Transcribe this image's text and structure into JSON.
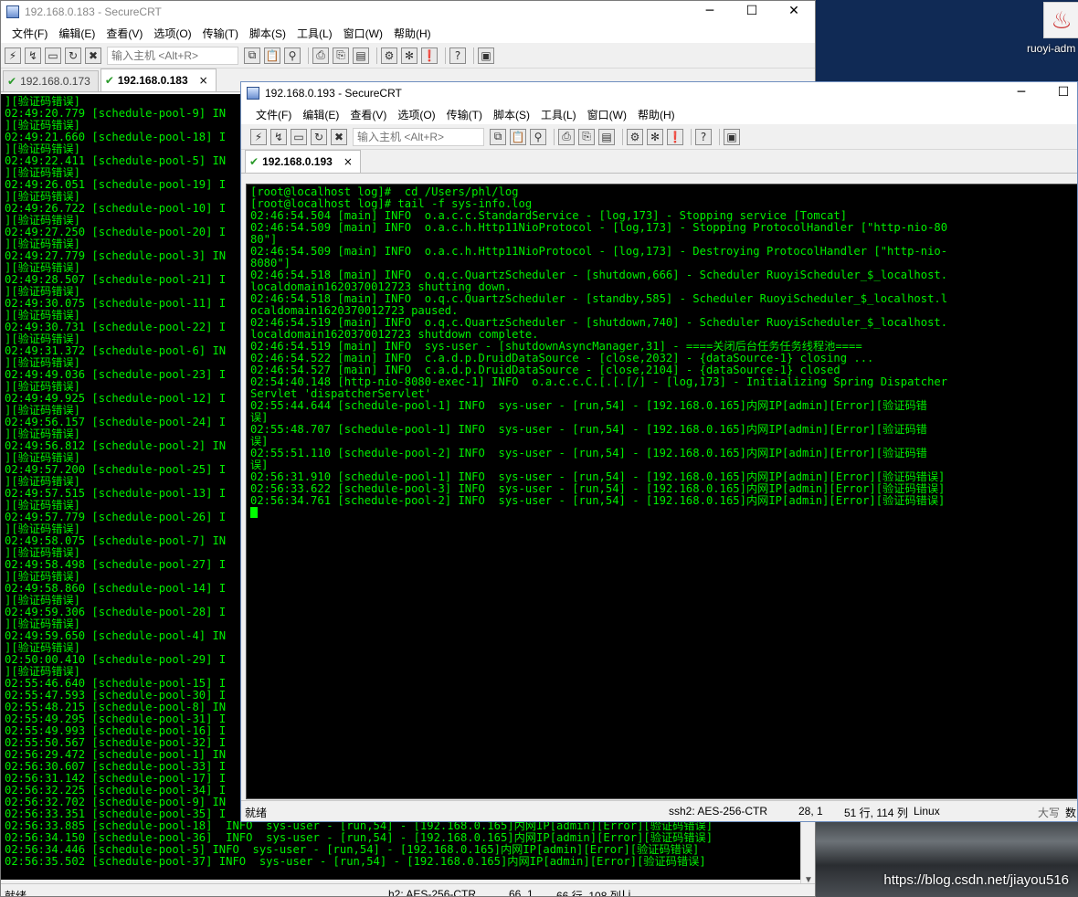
{
  "desktop": {
    "icon_label": "ruoyi-adm",
    "watermark": "https://blog.csdn.net/jiayou516"
  },
  "menu_items": [
    "文件(F)",
    "编辑(E)",
    "查看(V)",
    "选项(O)",
    "传输(T)",
    "脚本(S)",
    "工具(L)",
    "窗口(W)",
    "帮助(H)"
  ],
  "toolbar": {
    "host_placeholder": "输入主机 <Alt+R>"
  },
  "back_window": {
    "title": "192.168.0.183 - SecureCRT",
    "tabs": [
      {
        "label": "192.168.0.173",
        "active": false
      },
      {
        "label": "192.168.0.183",
        "active": true
      }
    ],
    "tab_close": "×",
    "terminal_lines": [
      "][验证码错误]",
      "02:49:20.779 [schedule-pool-9] IN",
      "][验证码错误]",
      "02:49:21.660 [schedule-pool-18] I",
      "][验证码错误]",
      "02:49:22.411 [schedule-pool-5] IN",
      "][验证码错误]",
      "02:49:26.051 [schedule-pool-19] I",
      "][验证码错误]",
      "02:49:26.722 [schedule-pool-10] I",
      "][验证码错误]",
      "02:49:27.250 [schedule-pool-20] I",
      "][验证码错误]",
      "02:49:27.779 [schedule-pool-3] IN",
      "][验证码错误]",
      "02:49:28.507 [schedule-pool-21] I",
      "][验证码错误]",
      "02:49:30.075 [schedule-pool-11] I",
      "][验证码错误]",
      "02:49:30.731 [schedule-pool-22] I",
      "][验证码错误]",
      "02:49:31.372 [schedule-pool-6] IN",
      "][验证码错误]",
      "02:49:49.036 [schedule-pool-23] I",
      "][验证码错误]",
      "02:49:49.925 [schedule-pool-12] I",
      "][验证码错误]",
      "02:49:56.157 [schedule-pool-24] I",
      "][验证码错误]",
      "02:49:56.812 [schedule-pool-2] IN",
      "][验证码错误]",
      "02:49:57.200 [schedule-pool-25] I",
      "][验证码错误]",
      "02:49:57.515 [schedule-pool-13] I",
      "][验证码错误]",
      "02:49:57.779 [schedule-pool-26] I",
      "][验证码错误]",
      "02:49:58.075 [schedule-pool-7] IN",
      "][验证码错误]",
      "02:49:58.498 [schedule-pool-27] I",
      "][验证码错误]",
      "02:49:58.860 [schedule-pool-14] I",
      "][验证码错误]",
      "02:49:59.306 [schedule-pool-28] I",
      "][验证码错误]",
      "02:49:59.650 [schedule-pool-4] IN",
      "][验证码错误]",
      "02:50:00.410 [schedule-pool-29] I",
      "][验证码错误]",
      "02:55:46.640 [schedule-pool-15] I",
      "02:55:47.593 [schedule-pool-30] I",
      "02:55:48.215 [schedule-pool-8] IN",
      "02:55:49.295 [schedule-pool-31] I",
      "02:55:49.993 [schedule-pool-16] I",
      "02:55:50.567 [schedule-pool-32] I",
      "02:56:29.472 [schedule-pool-1] IN",
      "02:56:30.607 [schedule-pool-33] I",
      "02:56:31.142 [schedule-pool-17] I",
      "02:56:32.225 [schedule-pool-34] I",
      "02:56:32.702 [schedule-pool-9] IN",
      "02:56:33.351 [schedule-pool-35] I",
      "02:56:33.885 [schedule-pool-18]  INFO  sys-user - [run,54] - [192.168.0.165]内网IP[admin][Error][验证码错误]",
      "02:56:34.150 [schedule-pool-36]  INFO  sys-user - [run,54] - [192.168.0.165]内网IP[admin][Error][验证码错误]",
      "02:56:34.446 [schedule-pool-5] INFO  sys-user - [run,54] - [192.168.0.165]内网IP[admin][Error][验证码错误]",
      "02:56:35.502 [schedule-pool-37] INFO  sys-user - [run,54] - [192.168.0.165]内网IP[admin][Error][验证码错误]"
    ],
    "status": {
      "ready": "就绪",
      "cipher": "h2: AES-256-CTR",
      "pos": "66,   1",
      "rows": "66 行, 108 列",
      "term": "Li"
    }
  },
  "front_window": {
    "title": "192.168.0.193 - SecureCRT",
    "tabs": [
      {
        "label": "192.168.0.193",
        "active": true
      }
    ],
    "tab_close": "×",
    "terminal_lines": [
      "[root@localhost log]#  cd /Users/phl/log",
      "[root@localhost log]# tail -f sys-info.log",
      "02:46:54.504 [main] INFO  o.a.c.c.StandardService - [log,173] - Stopping service [Tomcat]",
      "02:46:54.509 [main] INFO  o.a.c.h.Http11NioProtocol - [log,173] - Stopping ProtocolHandler [\"http-nio-80",
      "80\"]",
      "02:46:54.509 [main] INFO  o.a.c.h.Http11NioProtocol - [log,173] - Destroying ProtocolHandler [\"http-nio-",
      "8080\"]",
      "02:46:54.518 [main] INFO  o.q.c.QuartzScheduler - [shutdown,666] - Scheduler RuoyiScheduler_$_localhost.",
      "localdomain1620370012723 shutting down.",
      "02:46:54.518 [main] INFO  o.q.c.QuartzScheduler - [standby,585] - Scheduler RuoyiScheduler_$_localhost.l",
      "ocaldomain1620370012723 paused.",
      "02:46:54.519 [main] INFO  o.q.c.QuartzScheduler - [shutdown,740] - Scheduler RuoyiScheduler_$_localhost.",
      "localdomain1620370012723 shutdown complete.",
      "02:46:54.519 [main] INFO  sys-user - [shutdownAsyncManager,31] - ====关闭后台任务任务线程池====",
      "02:46:54.522 [main] INFO  c.a.d.p.DruidDataSource - [close,2032] - {dataSource-1} closing ...",
      "02:46:54.527 [main] INFO  c.a.d.p.DruidDataSource - [close,2104] - {dataSource-1} closed",
      "02:54:40.148 [http-nio-8080-exec-1] INFO  o.a.c.c.C.[.[.[/] - [log,173] - Initializing Spring Dispatcher",
      "Servlet 'dispatcherServlet'",
      "02:55:44.644 [schedule-pool-1] INFO  sys-user - [run,54] - [192.168.0.165]内网IP[admin][Error][验证码错",
      "误]",
      "02:55:48.707 [schedule-pool-1] INFO  sys-user - [run,54] - [192.168.0.165]内网IP[admin][Error][验证码错",
      "误]",
      "02:55:51.110 [schedule-pool-2] INFO  sys-user - [run,54] - [192.168.0.165]内网IP[admin][Error][验证码错",
      "误]",
      "02:56:31.910 [schedule-pool-1] INFO  sys-user - [run,54] - [192.168.0.165]内网IP[admin][Error][验证码错误]",
      "02:56:33.622 [schedule-pool-3] INFO  sys-user - [run,54] - [192.168.0.165]内网IP[admin][Error][验证码错误]",
      "02:56:34.761 [schedule-pool-2] INFO  sys-user - [run,54] - [192.168.0.165]内网IP[admin][Error][验证码错误]"
    ],
    "status": {
      "ready": "就绪",
      "cipher": "ssh2: AES-256-CTR",
      "pos": "28,   1",
      "rows": "51 行, 114 列",
      "term": "Linux",
      "caps": "大写",
      "num": "数"
    }
  },
  "colors": {
    "terminal_bg": "#000000",
    "terminal_fg": "#00ee00",
    "tab_check": "#2a9a2a"
  }
}
